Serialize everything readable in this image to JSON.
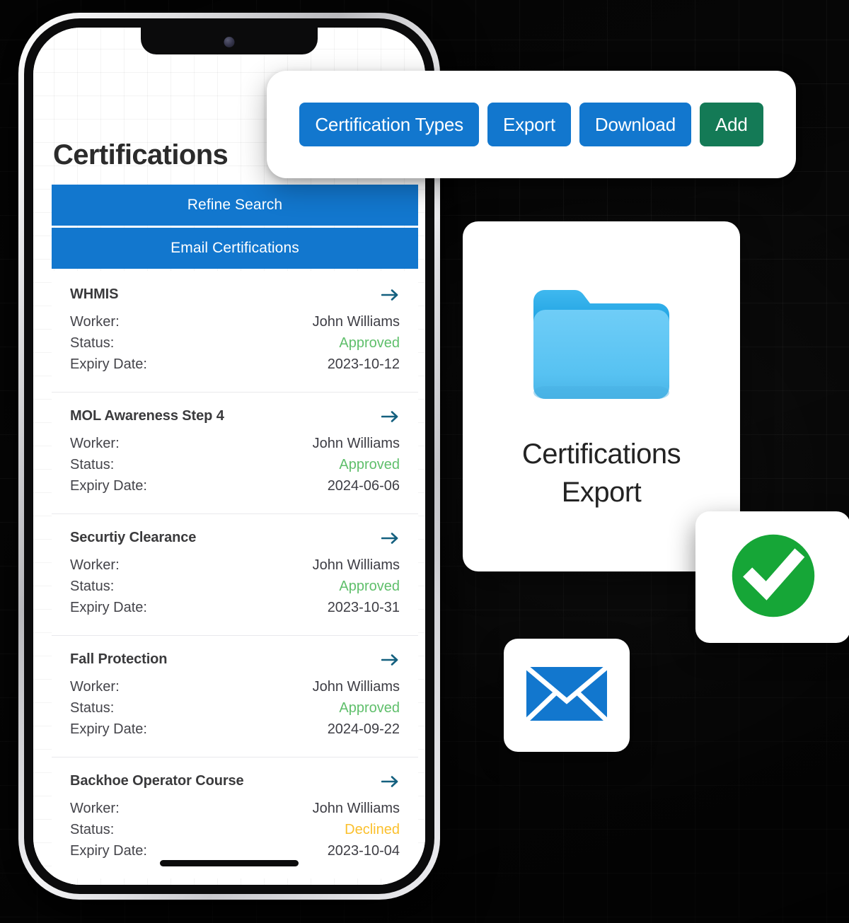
{
  "toolbar": {
    "buttons": [
      {
        "label": "Certification Types",
        "style": "primary"
      },
      {
        "label": "Export",
        "style": "primary"
      },
      {
        "label": "Download",
        "style": "primary"
      },
      {
        "label": "Add",
        "style": "success"
      }
    ]
  },
  "phone": {
    "page_title": "Certifications",
    "actions": {
      "refine_search": "Refine Search",
      "email_certifications": "Email Certifications"
    },
    "row_labels": {
      "worker": "Worker:",
      "status": "Status:",
      "expiry": "Expiry Date:"
    },
    "certifications": [
      {
        "name": "WHMIS",
        "worker": "John Williams",
        "status": "Approved",
        "status_kind": "approved",
        "expiry": "2023-10-12"
      },
      {
        "name": "MOL Awareness Step 4",
        "worker": "John Williams",
        "status": "Approved",
        "status_kind": "approved",
        "expiry": "2024-06-06"
      },
      {
        "name": "Securtiy Clearance",
        "worker": "John Williams",
        "status": "Approved",
        "status_kind": "approved",
        "expiry": "2023-10-31"
      },
      {
        "name": "Fall Protection",
        "worker": "John Williams",
        "status": "Approved",
        "status_kind": "approved",
        "expiry": "2024-09-22"
      },
      {
        "name": "Backhoe Operator Course",
        "worker": "John Williams",
        "status": "Declined",
        "status_kind": "declined",
        "expiry": "2023-10-04"
      }
    ]
  },
  "export_card": {
    "icon": "folder-icon",
    "label": "Certifications Export"
  },
  "check_card": {
    "icon": "check-circle-icon"
  },
  "mail_card": {
    "icon": "envelope-icon"
  },
  "colors": {
    "primary_blue": "#1277ce",
    "success_green": "#147a56",
    "check_green": "#16a637",
    "approved_green": "#5fbf6b",
    "declined_amber": "#fbc02d",
    "folder_blue": "#5cc5f2",
    "folder_blue_dark": "#1a9fe0",
    "arrow_teal": "#14607f",
    "backdrop": "#090909"
  }
}
